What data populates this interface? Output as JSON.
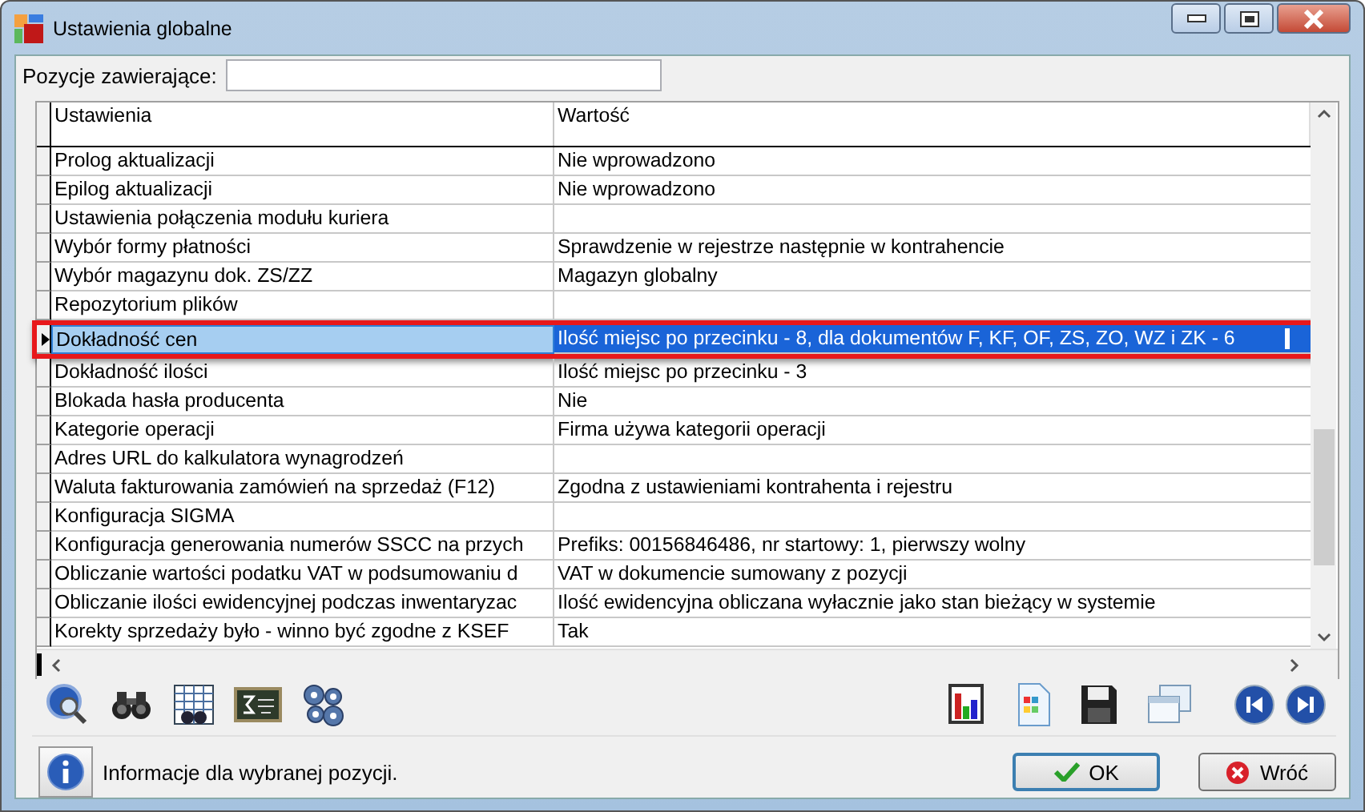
{
  "window": {
    "title": "Ustawienia globalne"
  },
  "filter": {
    "label": "Pozycje zawierające:"
  },
  "table": {
    "columns": [
      "Ustawienia",
      "Wartość"
    ],
    "rows": [
      {
        "name": "Prolog aktualizacji",
        "value": "Nie wprowadzono",
        "selected": false
      },
      {
        "name": "Epilog aktualizacji",
        "value": "Nie wprowadzono",
        "selected": false
      },
      {
        "name": "Ustawienia połączenia modułu kuriera",
        "value": "",
        "selected": false
      },
      {
        "name": "Wybór formy płatności",
        "value": "Sprawdzenie w rejestrze następnie w kontrahencie",
        "selected": false
      },
      {
        "name": "Wybór magazynu dok. ZS/ZZ",
        "value": "Magazyn globalny",
        "selected": false
      },
      {
        "name": "Repozytorium plików",
        "value": "",
        "selected": false
      },
      {
        "name": "Dokładność cen",
        "value": "Ilość miejsc po przecinku - 8, dla dokumentów F, KF, OF, ZS, ZO, WZ i ZK - 6",
        "selected": true
      },
      {
        "name": "Dokładność ilości",
        "value": "Ilość miejsc po przecinku - 3",
        "selected": false
      },
      {
        "name": "Blokada hasła producenta",
        "value": "Nie",
        "selected": false
      },
      {
        "name": "Kategorie operacji",
        "value": "Firma używa kategorii operacji",
        "selected": false
      },
      {
        "name": "Adres URL do kalkulatora wynagrodzeń",
        "value": "",
        "selected": false
      },
      {
        "name": "Waluta fakturowania zamówień na sprzedaż (F12)",
        "value": "Zgodna z ustawieniami kontrahenta i rejestru",
        "selected": false
      },
      {
        "name": "Konfiguracja SIGMA",
        "value": "",
        "selected": false
      },
      {
        "name": "Konfiguracja generowania numerów SSCC na przych",
        "value": "Prefiks: 00156846486, nr startowy: 1, pierwszy wolny",
        "selected": false
      },
      {
        "name": "Obliczanie wartości podatku VAT w podsumowaniu d",
        "value": "VAT w dokumencie sumowany z pozycji",
        "selected": false
      },
      {
        "name": "Obliczanie ilości ewidencyjnej podczas inwentaryzac",
        "value": "Ilość ewidencyjna obliczana wyłacznie jako stan bieżący w systemie",
        "selected": false
      },
      {
        "name": "Korekty sprzedaży było - winno być zgodne z KSEF",
        "value": "Tak",
        "selected": false
      }
    ]
  },
  "status": {
    "text": "Informacje dla wybranej pozycji."
  },
  "buttons": [
    {
      "kind": "ok",
      "label": "OK"
    },
    {
      "kind": "back",
      "label": "Wróć"
    }
  ]
}
